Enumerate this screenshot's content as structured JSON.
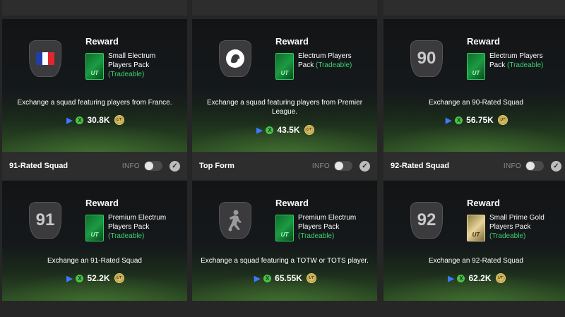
{
  "headers_mid": [
    {
      "title": "91-Rated Squad",
      "info": "INFO"
    },
    {
      "title": "Top Form",
      "info": "INFO"
    },
    {
      "title": "92-Rated Squad",
      "info": "INFO"
    }
  ],
  "cards": [
    {
      "reward": "Reward",
      "badge_text": "",
      "badge_kind": "flag-france",
      "pack_line1": "Small Electrum",
      "pack_line2": "Players Pack",
      "tradeable": "(Tradeable)",
      "pack_logo": "UT",
      "description": "Exchange a squad featuring players from France.",
      "price": "30.8K"
    },
    {
      "reward": "Reward",
      "badge_text": "",
      "badge_kind": "premier-league-lion",
      "pack_line1": "Electrum Players",
      "pack_line2": "Pack",
      "tradeable": "(Tradeable)",
      "pack_logo": "UT",
      "description": "Exchange a squad featuring players from Premier League.",
      "price": "43.5K"
    },
    {
      "reward": "Reward",
      "badge_text": "90",
      "badge_kind": "rating",
      "pack_line1": "Electrum Players",
      "pack_line2": "Pack",
      "tradeable": "(Tradeable)",
      "pack_logo": "UT",
      "description": "Exchange an 90-Rated Squad",
      "price": "56.75K"
    },
    {
      "reward": "Reward",
      "badge_text": "91",
      "badge_kind": "rating",
      "pack_line1": "Premium Electrum",
      "pack_line2": "Players Pack",
      "tradeable": "(Tradeable)",
      "pack_logo": "UT",
      "description": "Exchange an 91-Rated Squad",
      "price": "52.2K"
    },
    {
      "reward": "Reward",
      "badge_text": "",
      "badge_kind": "player-silhouette",
      "pack_line1": "Premium Electrum",
      "pack_line2": "Players Pack",
      "tradeable": "(Tradeable)",
      "pack_logo": "UT",
      "description": "Exchange a squad featuring a TOTW or TOTS player.",
      "price": "65.55K"
    },
    {
      "reward": "Reward",
      "badge_text": "92",
      "badge_kind": "rating",
      "pack_line1": "Small Prime Gold",
      "pack_line2": "Players Pack",
      "tradeable": "(Tradeable)",
      "pack_logo": "UT",
      "description": "Exchange an 92-Rated Squad",
      "price": "62.2K"
    }
  ],
  "icons": {
    "playstation": "playstation-icon",
    "xbox": "xbox-icon",
    "coin": "ut-coin-icon",
    "check": "check-icon"
  },
  "coin_label": "UT",
  "colors": {
    "tradeable": "#3cd070",
    "electrum_pack": "#1c9b43",
    "gold_pack": "#e8d39a"
  }
}
